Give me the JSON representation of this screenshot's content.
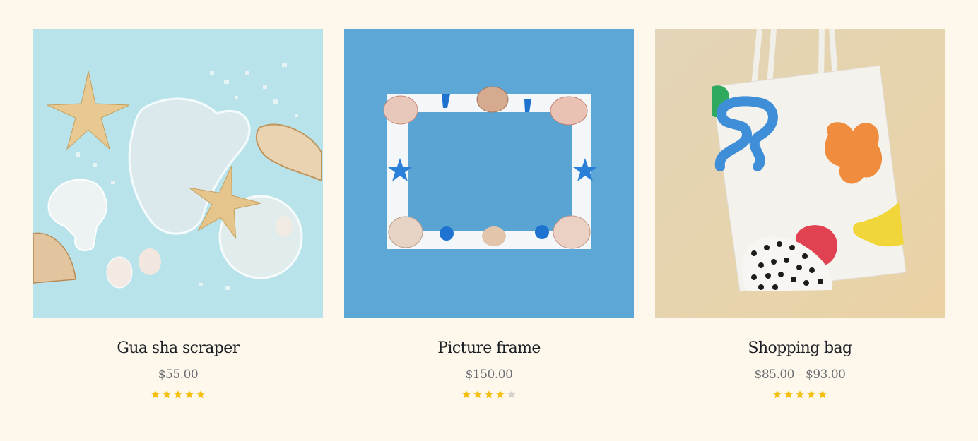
{
  "products": [
    {
      "title": "Gua sha scraper",
      "price": "$55.00",
      "rating": 5,
      "rating_max": 5,
      "image_desc": "gua-sha-image"
    },
    {
      "title": "Picture frame",
      "price": "$150.00",
      "rating": 4,
      "rating_max": 5,
      "image_desc": "picture-frame-image"
    },
    {
      "title": "Shopping bag",
      "price_min": "$85.00",
      "price_sep": "–",
      "price_max": "$93.00",
      "rating": 5,
      "rating_max": 5,
      "image_desc": "shopping-bag-image"
    }
  ],
  "colors": {
    "page_background": "#fef8ec",
    "star_filled": "#f5bf0f",
    "star_empty": "#d3d1cc",
    "title_text": "#1c1f24",
    "price_text": "#6b6e73"
  }
}
